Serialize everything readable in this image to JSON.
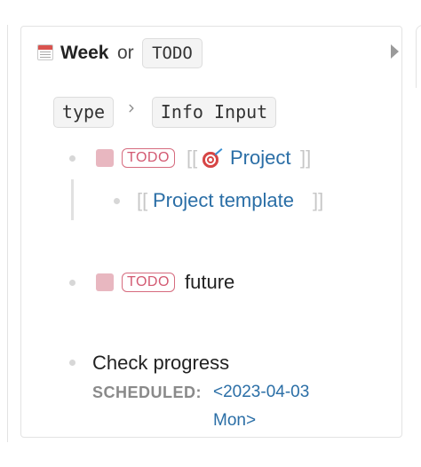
{
  "query": {
    "title_word": "Week",
    "title_connector": "or",
    "title_marker": "TODO",
    "icon": "calendar-icon",
    "collapse_icon": "triangle-right-icon"
  },
  "breadcrumb": {
    "items": [
      "type",
      "Info Input"
    ],
    "separator_icon": "chevron-right-icon"
  },
  "blocks": [
    {
      "marker": "TODO",
      "open_bracket": "[[",
      "icon": "target-icon",
      "page_link": "Project",
      "close_bracket": "]]",
      "children": [
        {
          "open_bracket": "[[",
          "page_link": "Project template",
          "close_bracket": "]]"
        }
      ]
    },
    {
      "marker": "TODO",
      "text": "future"
    },
    {
      "text": "Check progress",
      "scheduled_label": "SCHEDULED:",
      "scheduled_value_line1": "<2023-04-03",
      "scheduled_value_line2": "Mon>"
    }
  ],
  "colors": {
    "link": "#2a6ea6",
    "todo_badge": "#d35a72",
    "checkbox": "#e8b7c0",
    "bracket": "#c7c7c7",
    "bullet": "#d7d7d7"
  }
}
